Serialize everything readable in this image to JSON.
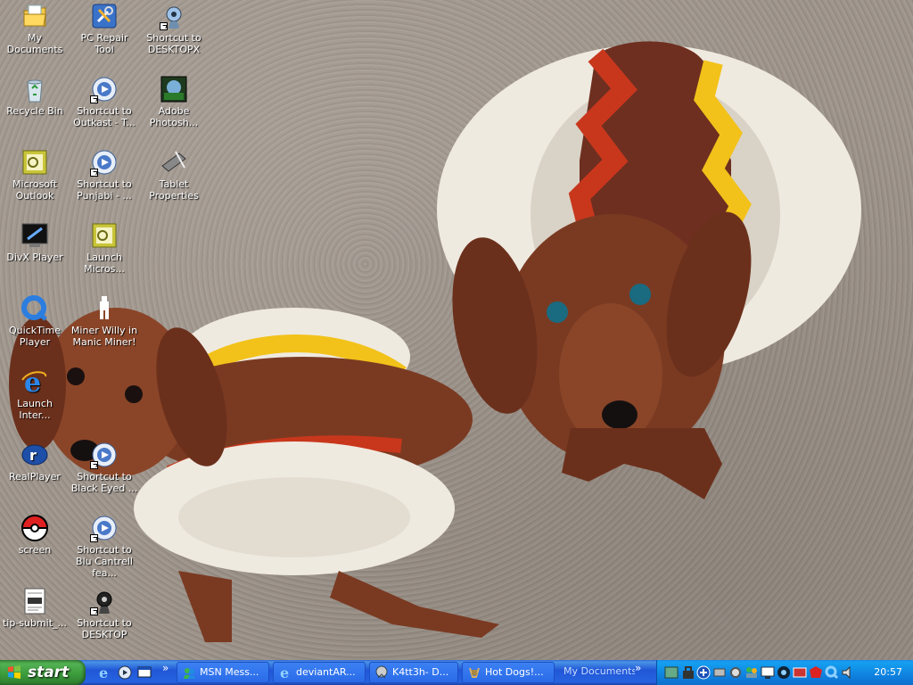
{
  "desktop": {
    "icons": [
      {
        "label": "My Documents",
        "icon": "my-documents-icon"
      },
      {
        "label": "PC Repair Tool",
        "icon": "pc-repair-tool-icon"
      },
      {
        "label": "Shortcut to DESKTOPX",
        "icon": "desktopx-shortcut-icon"
      },
      {
        "label": "Recycle Bin",
        "icon": "recycle-bin-icon"
      },
      {
        "label": "Shortcut to Outkast - T...",
        "icon": "media-shortcut-icon"
      },
      {
        "label": "Adobe Photosh...",
        "icon": "adobe-photoshop-icon"
      },
      {
        "label": "Microsoft Outlook",
        "icon": "outlook-icon"
      },
      {
        "label": "Shortcut to Punjabi - ...",
        "icon": "media-shortcut-icon"
      },
      {
        "label": "Tablet Properties",
        "icon": "tablet-properties-icon"
      },
      {
        "label": "DivX Player",
        "icon": "divx-player-icon"
      },
      {
        "label": "Launch Micros...",
        "icon": "outlook-icon"
      },
      {
        "label": "QuickTime Player",
        "icon": "quicktime-icon"
      },
      {
        "label": "Miner Willy in Manic Miner!",
        "icon": "manic-miner-icon"
      },
      {
        "label": "Launch Inter...",
        "icon": "internet-explorer-icon"
      },
      {
        "label": "RealPlayer",
        "icon": "realplayer-icon"
      },
      {
        "label": "Shortcut to Black Eyed ...",
        "icon": "media-shortcut-icon"
      },
      {
        "label": "screen",
        "icon": "pokeball-icon"
      },
      {
        "label": "Shortcut to Blu Cantrell fea...",
        "icon": "media-shortcut-icon"
      },
      {
        "label": "tip-submit_...",
        "icon": "text-file-icon"
      },
      {
        "label": "Shortcut to DESKTOP",
        "icon": "desktop-shortcut-icon"
      }
    ]
  },
  "taskbar": {
    "start_label": "start",
    "tasks": [
      {
        "label": "MSN Mess...",
        "icon": "msn-icon"
      },
      {
        "label": "deviantAR...",
        "icon": "ie-icon"
      },
      {
        "label": "K4tt3h- D...",
        "icon": "chat-icon"
      },
      {
        "label": "Hot Dogs!...",
        "icon": "hotdog-icon"
      }
    ],
    "toolbar_label": "My Documents",
    "clock": "20:57"
  },
  "colors": {
    "taskbar_blue": "#2663e0",
    "start_green": "#3a9a3a",
    "tray_blue": "#0f82e0"
  }
}
